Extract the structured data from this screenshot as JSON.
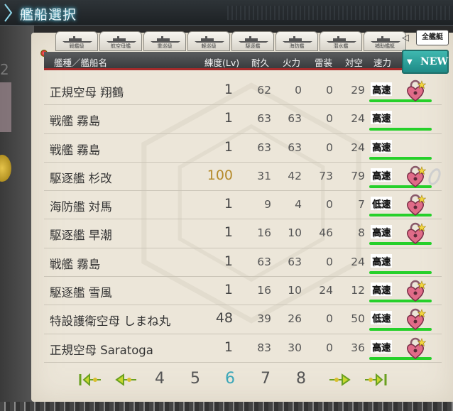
{
  "header": {
    "title": "艦船選択"
  },
  "left": {
    "digit": "2"
  },
  "tabs": [
    {
      "label": "戦艦級"
    },
    {
      "label": "航空母艦"
    },
    {
      "label": "重巡級"
    },
    {
      "label": "軽巡級"
    },
    {
      "label": "駆逐艦"
    },
    {
      "label": "海防艦"
    },
    {
      "label": "潜水艦"
    },
    {
      "label": "補助艦艇"
    }
  ],
  "all_tab": {
    "label": "全艦艇"
  },
  "columns": {
    "name": "艦種／艦船名",
    "lv": "練度(Lv)",
    "dur": "耐久",
    "fire": "火力",
    "torp": "雷装",
    "aa": "対空",
    "speed": "速力"
  },
  "new_button": {
    "label": "NEW"
  },
  "ships": [
    {
      "name": "正規空母 翔鶴",
      "lv": "1",
      "dur": "62",
      "fire": "0",
      "torp": "0",
      "aa": "29",
      "speed": "高速",
      "lock": true,
      "ring": false,
      "lv_gold": false
    },
    {
      "name": "戦艦 霧島",
      "lv": "1",
      "dur": "63",
      "fire": "63",
      "torp": "0",
      "aa": "24",
      "speed": "高速",
      "lock": false,
      "ring": false,
      "lv_gold": false
    },
    {
      "name": "戦艦 霧島",
      "lv": "1",
      "dur": "63",
      "fire": "63",
      "torp": "0",
      "aa": "24",
      "speed": "高速",
      "lock": false,
      "ring": false,
      "lv_gold": false
    },
    {
      "name": "駆逐艦 杉改",
      "lv": "100",
      "dur": "31",
      "fire": "42",
      "torp": "73",
      "aa": "79",
      "speed": "高速",
      "lock": true,
      "ring": true,
      "lv_gold": true
    },
    {
      "name": "海防艦 対馬",
      "lv": "1",
      "dur": "9",
      "fire": "4",
      "torp": "0",
      "aa": "7",
      "speed": "低速",
      "lock": true,
      "ring": false,
      "lv_gold": false
    },
    {
      "name": "駆逐艦 早潮",
      "lv": "1",
      "dur": "16",
      "fire": "10",
      "torp": "46",
      "aa": "8",
      "speed": "高速",
      "lock": true,
      "ring": false,
      "lv_gold": false
    },
    {
      "name": "戦艦 霧島",
      "lv": "1",
      "dur": "63",
      "fire": "63",
      "torp": "0",
      "aa": "24",
      "speed": "高速",
      "lock": false,
      "ring": false,
      "lv_gold": false
    },
    {
      "name": "駆逐艦 雪風",
      "lv": "1",
      "dur": "16",
      "fire": "10",
      "torp": "24",
      "aa": "12",
      "speed": "高速",
      "lock": true,
      "ring": false,
      "lv_gold": false
    },
    {
      "name": "特設護衛空母 しまね丸",
      "lv": "48",
      "dur": "39",
      "fire": "26",
      "torp": "0",
      "aa": "50",
      "speed": "低速",
      "lock": true,
      "ring": false,
      "lv_gold": false
    },
    {
      "name": "正規空母 Saratoga",
      "lv": "1",
      "dur": "83",
      "fire": "30",
      "torp": "0",
      "aa": "36",
      "speed": "高速",
      "lock": true,
      "ring": false,
      "lv_gold": false
    }
  ],
  "pager": {
    "pages": [
      "4",
      "5",
      "6",
      "7",
      "8"
    ],
    "current": "6"
  },
  "colors": {
    "accent": "#3aa6b8",
    "header_line": "#a42a2a",
    "speed_bar": "#26d02a",
    "lock": "#e06b88"
  }
}
